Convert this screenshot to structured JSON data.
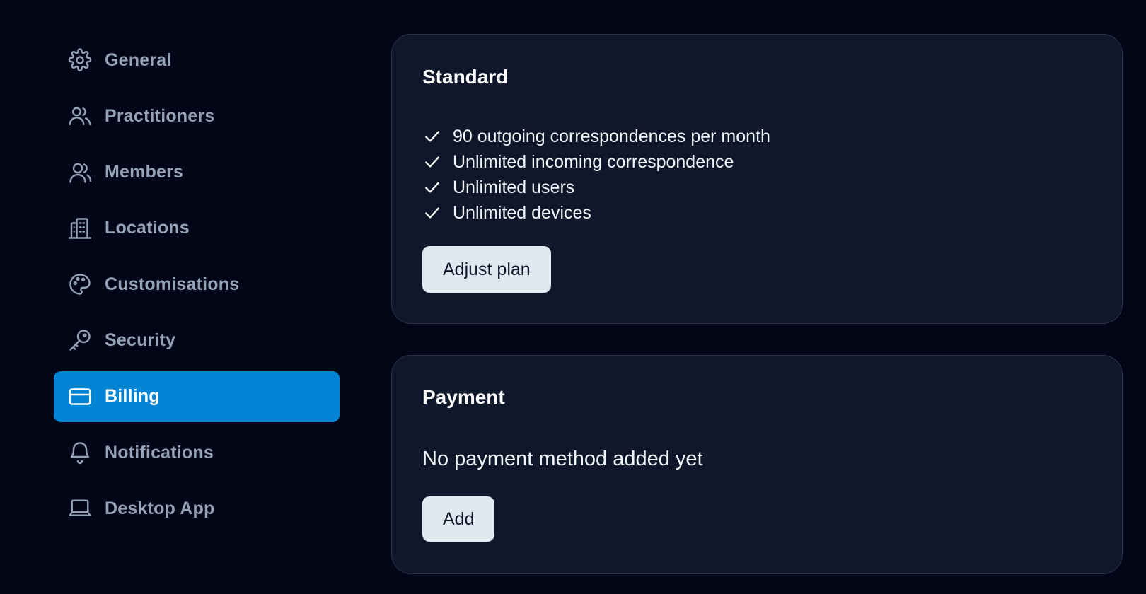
{
  "sidebar": {
    "items": [
      {
        "label": "General",
        "icon": "gear-icon",
        "active": false
      },
      {
        "label": "Practitioners",
        "icon": "users-icon",
        "active": false
      },
      {
        "label": "Members",
        "icon": "user-group-icon",
        "active": false
      },
      {
        "label": "Locations",
        "icon": "building-icon",
        "active": false
      },
      {
        "label": "Customisations",
        "icon": "palette-icon",
        "active": false
      },
      {
        "label": "Security",
        "icon": "key-icon",
        "active": false
      },
      {
        "label": "Billing",
        "icon": "credit-card-icon",
        "active": true
      },
      {
        "label": "Notifications",
        "icon": "bell-icon",
        "active": false
      },
      {
        "label": "Desktop App",
        "icon": "laptop-icon",
        "active": false
      }
    ]
  },
  "plan": {
    "title": "Standard",
    "features": [
      "90 outgoing correspondences per month",
      "Unlimited incoming correspondence",
      "Unlimited users",
      "Unlimited devices"
    ],
    "adjust_label": "Adjust plan"
  },
  "payment": {
    "title": "Payment",
    "empty_text": "No payment method added yet",
    "add_label": "Add"
  },
  "colors": {
    "background": "#030617",
    "card": "#0f172a",
    "card_border": "#2a3446",
    "accent": "#0284d4",
    "muted_text": "#94a3b8",
    "button_bg": "#e2e8f0"
  }
}
